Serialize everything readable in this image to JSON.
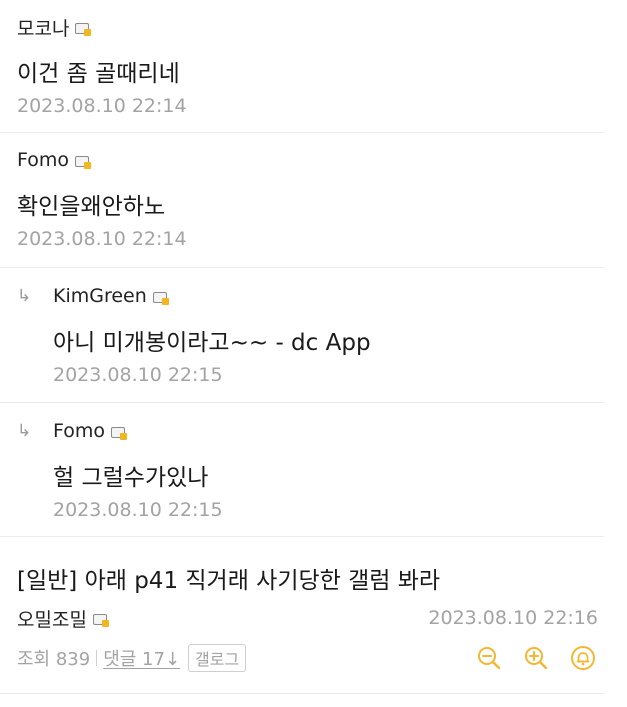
{
  "colors": {
    "accent": "#f5b731",
    "muted": "#a3a3a3",
    "text": "#1a1a1a",
    "divider": "#ececec"
  },
  "comments": [
    {
      "nickname": "모코나",
      "text": "이건 좀 골때리네",
      "date": "2023.08.10 22:14",
      "is_reply": false
    },
    {
      "nickname": "Fomo",
      "text": "확인을왜안하노",
      "date": "2023.08.10 22:14",
      "is_reply": false
    },
    {
      "nickname": "KimGreen",
      "text": "아니 미개봉이라고~~ - dc App",
      "date": "2023.08.10 22:15",
      "is_reply": true
    },
    {
      "nickname": "Fomo",
      "text": "헐 그럴수가있나",
      "date": "2023.08.10 22:15",
      "is_reply": true
    }
  ],
  "reply_arrow_glyph": "↳",
  "post": {
    "title": "[일반] 아래 p41 직거래 사기당한 갤럼 봐라",
    "author": "오밀조밀",
    "date": "2023.08.10 22:16",
    "views_label": "조회 839",
    "comments_label": "댓글 17↓",
    "gallog_label": "갤로그",
    "tool_icons": [
      "zoom-out-icon",
      "zoom-in-icon",
      "bell-icon"
    ]
  }
}
